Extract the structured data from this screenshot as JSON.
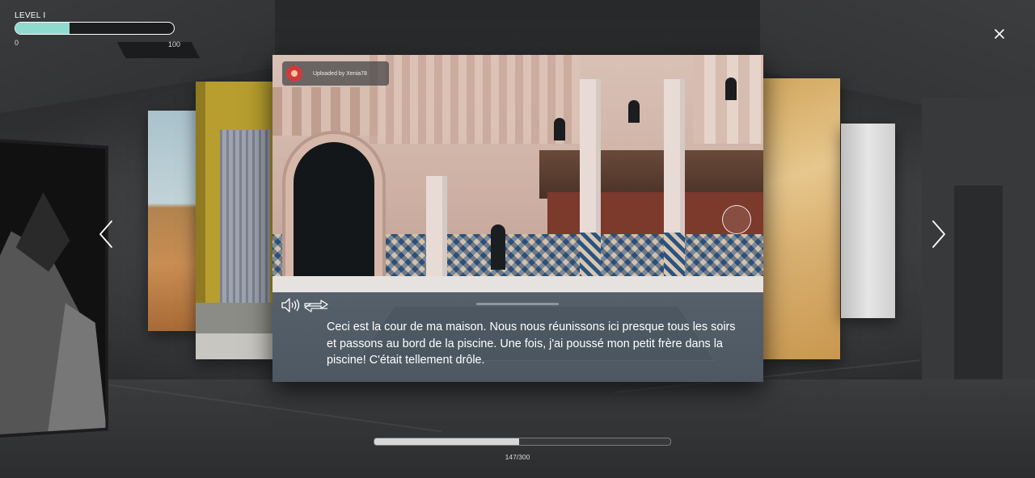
{
  "hud": {
    "level_label": "LEVEL I",
    "level_min": "0",
    "level_max": "100",
    "level_progress_fraction": 0.34
  },
  "card": {
    "uploader_label": "Uploaded by Xenia78",
    "caption": "Ceci est la cour de ma maison. Nous nous réunissons ici presque tous les soirs et passons au bord de la piscine. Une fois, j'ai poussé mon petit frère dans la piscine! C'était tellement drôle."
  },
  "progress": {
    "text": "147/300",
    "current": 147,
    "total": 300
  },
  "icons": {
    "close": "close-icon",
    "prev": "chevron-left-icon",
    "next": "chevron-right-icon",
    "audio": "speaker-icon",
    "translate": "swap-arrows-icon",
    "avatar": "user-avatar-icon"
  },
  "colors": {
    "level_fill": "#8fdccf",
    "avatar": "#d23a3a",
    "caption_bg": "#525c67"
  }
}
